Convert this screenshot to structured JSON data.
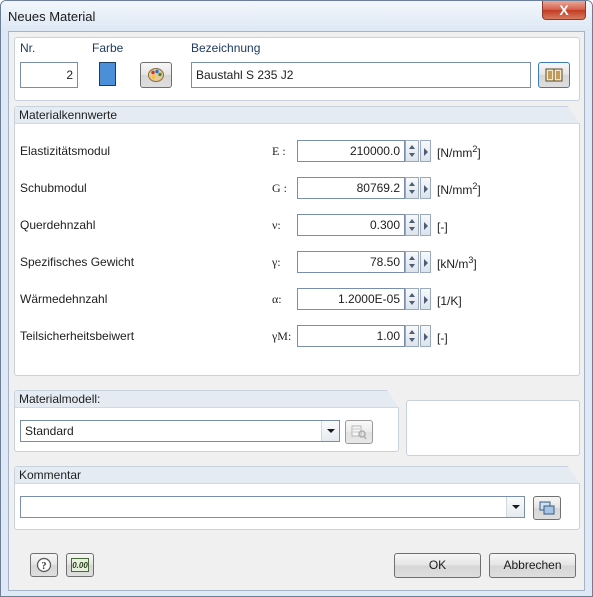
{
  "window": {
    "title": "Neues Material",
    "close_label": "X"
  },
  "header": {
    "nr_label": "Nr.",
    "nr_value": "2",
    "farbe_label": "Farbe",
    "farbe_color": "#4a8fd8",
    "bezeichnung_label": "Bezeichnung",
    "bezeichnung_value": "Baustahl S 235 J2"
  },
  "properties": {
    "title": "Materialkennwerte",
    "rows": [
      {
        "label": "Elastizitätsmodul",
        "symbol": "E :",
        "value": "210000.0",
        "unit_pre": "[N/mm",
        "unit_sup": "2",
        "unit_post": "]"
      },
      {
        "label": "Schubmodul",
        "symbol": "G :",
        "value": "80769.2",
        "unit_pre": "[N/mm",
        "unit_sup": "2",
        "unit_post": "]"
      },
      {
        "label": "Querdehnzahl",
        "symbol": "ν:",
        "value": "0.300",
        "unit_pre": "[-]",
        "unit_sup": "",
        "unit_post": ""
      },
      {
        "label": "Spezifisches Gewicht",
        "symbol": "γ:",
        "value": "78.50",
        "unit_pre": "[kN/m",
        "unit_sup": "3",
        "unit_post": "]"
      },
      {
        "label": "Wärmedehnzahl",
        "symbol": "α:",
        "value": "1.2000E-05",
        "unit_pre": "[1/K]",
        "unit_sup": "",
        "unit_post": ""
      },
      {
        "label": "Teilsicherheitsbeiwert",
        "symbol": "γM:",
        "value": "1.00",
        "unit_pre": "[-]",
        "unit_sup": "",
        "unit_post": ""
      }
    ]
  },
  "material_model": {
    "title": "Materialmodell:",
    "selected": "Standard"
  },
  "comment": {
    "title": "Kommentar",
    "value": ""
  },
  "footer": {
    "ok_label": "OK",
    "cancel_label": "Abbrechen",
    "calc_label": "0.00"
  },
  "colors": {
    "accent": "#4a8fd8",
    "close": "#c23c22"
  }
}
